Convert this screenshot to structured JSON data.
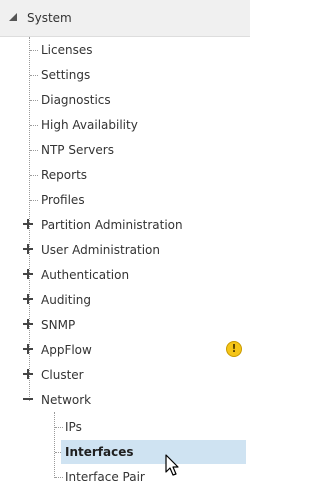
{
  "root": {
    "label": "System",
    "expanded": true
  },
  "items": [
    {
      "label": "Licenses",
      "kind": "leaf"
    },
    {
      "label": "Settings",
      "kind": "leaf"
    },
    {
      "label": "Diagnostics",
      "kind": "leaf"
    },
    {
      "label": "High Availability",
      "kind": "leaf"
    },
    {
      "label": "NTP Servers",
      "kind": "leaf"
    },
    {
      "label": "Reports",
      "kind": "leaf"
    },
    {
      "label": "Profiles",
      "kind": "leaf"
    },
    {
      "label": "Partition Administration",
      "kind": "collapsed"
    },
    {
      "label": "User Administration",
      "kind": "collapsed"
    },
    {
      "label": "Authentication",
      "kind": "collapsed"
    },
    {
      "label": "Auditing",
      "kind": "collapsed"
    },
    {
      "label": "SNMP",
      "kind": "collapsed"
    },
    {
      "label": "AppFlow",
      "kind": "collapsed",
      "badge": "!",
      "badge_icon": "warning-icon",
      "badge_color": "#f5c518"
    },
    {
      "label": "Cluster",
      "kind": "collapsed"
    },
    {
      "label": "Network",
      "kind": "expanded"
    }
  ],
  "network_children": [
    {
      "label": "IPs",
      "selected": false
    },
    {
      "label": "Interfaces",
      "selected": true
    },
    {
      "label": "Interface Pair",
      "selected": false
    }
  ],
  "colors": {
    "selected_background": "#cfe3f2",
    "header_background": "#f0f0f0",
    "text": "#333333",
    "tree_line": "#9a9a9a",
    "warning": "#f5c518"
  },
  "icons": {
    "root_expander": "expanded-arrow-icon",
    "collapsed": "plus-icon",
    "expanded": "minus-icon",
    "cursor": "mouse-pointer-icon"
  }
}
